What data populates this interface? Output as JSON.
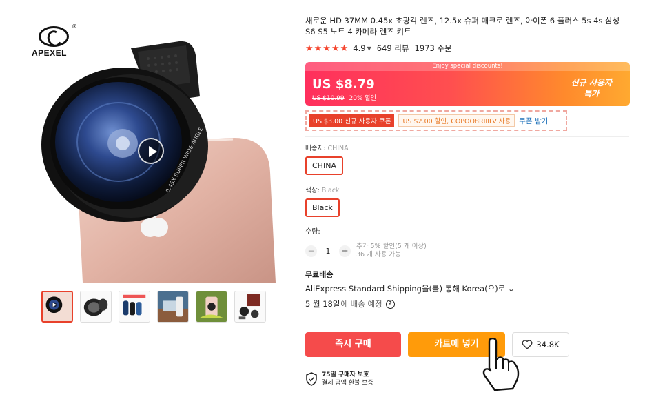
{
  "brand": {
    "name": "APEXEL",
    "reg": "®"
  },
  "product": {
    "title": "새로운 HD 37MM 0.45x 초광각 렌즈, 12.5x 슈퍼 매크로 렌즈, 아이폰 6 플러스 5s 4s 삼성 S6 S5 노트 4 카메라 렌즈 키트",
    "rating_stars": "★★★★★",
    "rating": "4.9",
    "reviews": "649 리뷰",
    "orders": "1973 주문"
  },
  "price": {
    "promo_strip": "Enjoy special discounts!",
    "current": "US $8.79",
    "original": "US $10.99",
    "discount": "20% 할인",
    "new_user_line1": "신규 사용자",
    "new_user_line2": "특가"
  },
  "coupons": {
    "new_user": "US $3.00 신규 사용자 쿠폰",
    "code": "US $2.00 할인, COPOO8RIIILV 사용",
    "get_link": "쿠폰 받기"
  },
  "options": {
    "ship_from_label": "배송지:",
    "ship_from_value": "CHINA",
    "ship_from_chip": "CHINA",
    "color_label": "색상:",
    "color_value": "Black",
    "color_chip": "Black"
  },
  "quantity": {
    "label": "수량:",
    "value": "1",
    "minus": "−",
    "plus": "+",
    "info_line1": "추가 5% 할인(5 개 이상)",
    "info_line2": "36 개 사용 가능"
  },
  "shipping": {
    "title": "무료배송",
    "method": "AliExpress Standard Shipping을(를) 통해 Korea(으)로",
    "caret": "⌄",
    "eta_date": "5 월 18일",
    "eta_suffix": "에 배송 예정",
    "help": "?"
  },
  "actions": {
    "buy_now": "즉시 구매",
    "add_to_cart": "카트에 넣기",
    "wishlist_count": "34.8K"
  },
  "protection": {
    "line1": "75일 구매자 보호",
    "line2": "결제 금액 환불 보증"
  },
  "colors": {
    "accent_red": "#e8412b",
    "buy_red": "#f54b4b",
    "cart_orange": "#ff9b0a",
    "link_blue": "#1b6fb8"
  }
}
